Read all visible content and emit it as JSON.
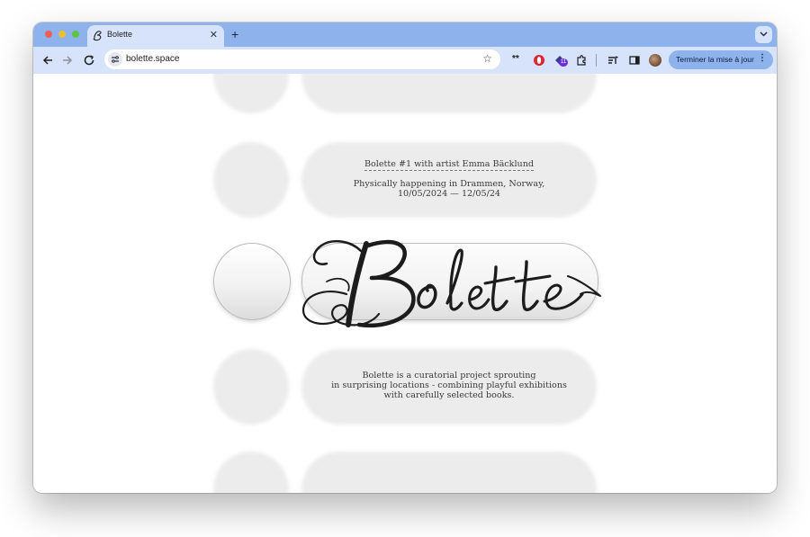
{
  "browser": {
    "tab": {
      "title": "Bolette",
      "favicon": "bolette-logo-icon"
    },
    "address_bar": {
      "url": "bolette.space"
    },
    "toolbar": {
      "extensions": [
        "password-dots-icon",
        "opera-icon",
        "badge-extension-icon",
        "puzzle-icon",
        "reading-list-icon",
        "side-panel-icon"
      ],
      "update_button_label": "Terminer la mise à jour",
      "badge_count": "11"
    }
  },
  "page": {
    "logo_text": "Bolette",
    "event_title": "Bolette #1 with artist Emma Bäcklund",
    "event_location": "Physically happening in Drammen, Norway,",
    "event_dates": "10/05/2024 — 12/05/24",
    "description_lines": [
      "Bolette is a curatorial project sprouting",
      "in surprising locations - combining playful exhibitions",
      "with carefully selected books."
    ]
  }
}
